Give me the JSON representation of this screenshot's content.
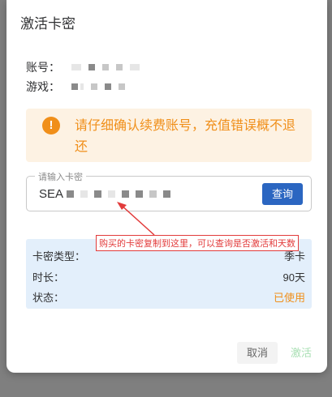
{
  "dialog": {
    "title": "激活卡密",
    "account_label": "账号：",
    "game_label": "游戏："
  },
  "warning": {
    "icon": "exclamation-icon",
    "text": "请仔细确认续费账号，充值错误概不退还",
    "color": "#f08f1a"
  },
  "card_input": {
    "label": "请输入卡密",
    "value_prefix": "SEA",
    "query_button": "查询"
  },
  "annotation": {
    "text": "购买的卡密复制到这里，可以查询是否激活和天数",
    "color": "#e23b3b"
  },
  "result": {
    "type_label": "卡密类型：",
    "type_value": "季卡",
    "duration_label": "时长：",
    "duration_value": "90天",
    "status_label": "状态：",
    "status_value": "已使用"
  },
  "footer": {
    "cancel": "取消",
    "activate": "激活"
  },
  "colors": {
    "primary": "#2b66c1",
    "warning": "#f08f1a",
    "info_bg": "#e3effb"
  }
}
